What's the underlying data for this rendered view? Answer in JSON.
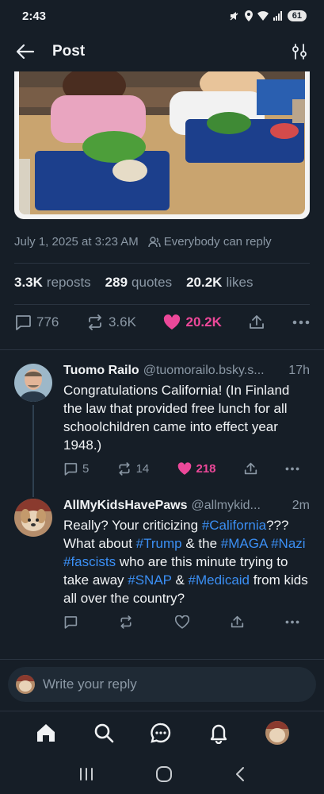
{
  "status_bar": {
    "time": "2:43",
    "battery": "61"
  },
  "header": {
    "title": "Post"
  },
  "post": {
    "date": "July 1, 2025 at 3:23 AM",
    "reply_setting": "Everybody can reply",
    "reposts_count": "3.3K",
    "reposts_label": "reposts",
    "quotes_count": "289",
    "quotes_label": "quotes",
    "likes_count": "20.2K",
    "likes_label": "likes",
    "actions": {
      "replies": "776",
      "reposts": "3.6K",
      "likes": "20.2K"
    }
  },
  "replies": [
    {
      "name": "Tuomo Railo",
      "handle": "@tuomorailo.bsky.s...",
      "time": "17h",
      "text": "Congratulations California! (In Finland the law that provided free lunch for all schoolchildren came into effect year 1948.)",
      "replies": "5",
      "reposts": "14",
      "likes": "218"
    },
    {
      "name": "AllMyKidsHavePaws",
      "handle": "@allmykid...",
      "time": "2m",
      "text_parts": {
        "p1": "Really? Your criticizing ",
        "h1": "#California",
        "p2": "??? What about ",
        "h2": "#Trump",
        "p3": " & the ",
        "h3": "#MAGA",
        "p4": " ",
        "h4": "#Nazi",
        "p5": " ",
        "h5": "#fascists",
        "p6": " who are this minute trying to take away ",
        "h6": "#SNAP",
        "p7": " & ",
        "h7": "#Medicaid",
        "p8": " from kids all over the country?"
      }
    }
  ],
  "composer": {
    "placeholder": "Write your reply"
  },
  "colors": {
    "background": "#161e27",
    "like": "#ec4899",
    "hashtag": "#3b8ff4",
    "muted": "#8b98a5"
  }
}
